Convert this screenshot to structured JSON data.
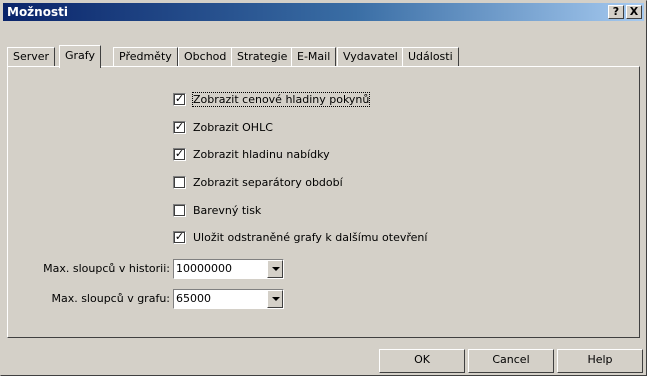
{
  "window": {
    "title": "Možnosti",
    "help_label": "?",
    "close_label": "X"
  },
  "tabs": [
    {
      "label": "Server",
      "active": false
    },
    {
      "label": "Grafy",
      "active": true
    },
    {
      "label": "Předměty",
      "active": false
    },
    {
      "label": "Obchod",
      "active": false
    },
    {
      "label": "Strategie",
      "active": false
    },
    {
      "label": "E-Mail",
      "active": false
    },
    {
      "label": "Vydavatel",
      "active": false
    },
    {
      "label": "Události",
      "active": false
    }
  ],
  "options": [
    {
      "label": "Zobrazit cenové hladiny pokynů",
      "checked": true
    },
    {
      "label": "Zobrazit OHLC",
      "checked": true
    },
    {
      "label": "Zobrazit hladinu nabídky",
      "checked": true
    },
    {
      "label": "Zobrazit separátory období",
      "checked": false
    },
    {
      "label": "Barevný tisk",
      "checked": false
    },
    {
      "label": "Uložit odstraněné grafy k dalšímu otevření",
      "checked": true
    }
  ],
  "fields": {
    "max_history_label": "Max. sloupců v historii:",
    "max_history_value": "10000000",
    "max_chart_label": "Max. sloupců v grafu:",
    "max_chart_value": "65000"
  },
  "buttons": {
    "ok": "OK",
    "cancel": "Cancel",
    "help": "Help"
  }
}
